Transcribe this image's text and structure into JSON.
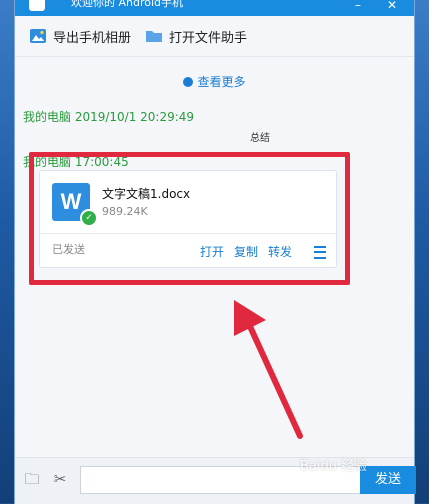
{
  "window": {
    "title": "欢迎你的 Android手机"
  },
  "toolbar": {
    "export_label": "导出手机相册",
    "open_helper_label": "打开文件助手"
  },
  "chat": {
    "more_label": "查看更多",
    "messages": [
      {
        "sender": "我的电脑 2019/10/1 20:29:49",
        "text": "总结"
      },
      {
        "sender": "我的电脑 17:00:45"
      }
    ],
    "file": {
      "name": "文字文稿1.docx",
      "size": "989.24K",
      "status": "已发送",
      "actions": {
        "open": "打开",
        "copy": "复制",
        "forward": "转发"
      }
    }
  },
  "bottom": {
    "send_label": "发送"
  },
  "watermark": "Baidu 经验",
  "colors": {
    "accent": "#1a8ce0",
    "sender": "#2a9a3d",
    "highlight": "#e0283e",
    "link": "#1a7fd4"
  },
  "icons": [
    "gallery-icon",
    "folder-icon",
    "clock-icon",
    "word-file-icon",
    "checkmark-icon",
    "menu-icon",
    "folder-icon",
    "scissors-icon"
  ]
}
